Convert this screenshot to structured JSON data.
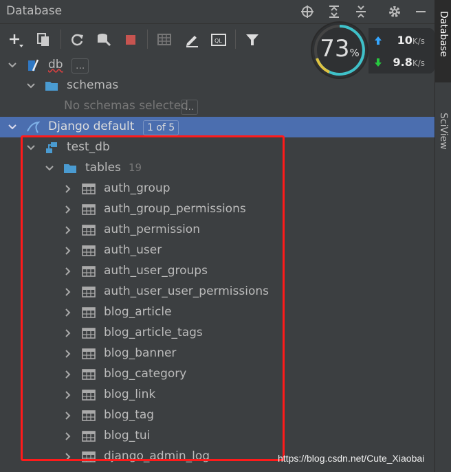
{
  "header": {
    "title": "Database"
  },
  "side_tabs": {
    "database": "Database",
    "sciview": "SciView"
  },
  "speed_meter": {
    "percent": "73",
    "percent_unit": "%",
    "up": "10",
    "up_unit": "K/s",
    "down": "9.8",
    "down_unit": "K/s"
  },
  "tree": {
    "db": {
      "label": "db",
      "ellipsis": "..."
    },
    "schemas": {
      "label": "schemas",
      "hint": "No schemas selected",
      "ellipsis": "..."
    },
    "django": {
      "label": "Django default",
      "badge": "1 of 5"
    },
    "test_db": {
      "label": "test_db"
    },
    "tables": {
      "label": "tables",
      "count": "19"
    },
    "table_items": [
      "auth_group",
      "auth_group_permissions",
      "auth_permission",
      "auth_user",
      "auth_user_groups",
      "auth_user_user_permissions",
      "blog_article",
      "blog_article_tags",
      "blog_banner",
      "blog_category",
      "blog_link",
      "blog_tag",
      "blog_tui",
      "django_admin_log"
    ]
  },
  "watermark": "https://blog.csdn.net/Cute_Xiaobai",
  "colors": {
    "background": "#3c3f41",
    "selection": "#4b6eaf",
    "highlight_box": "#ff1a1a",
    "folder": "#4a9bd1"
  }
}
